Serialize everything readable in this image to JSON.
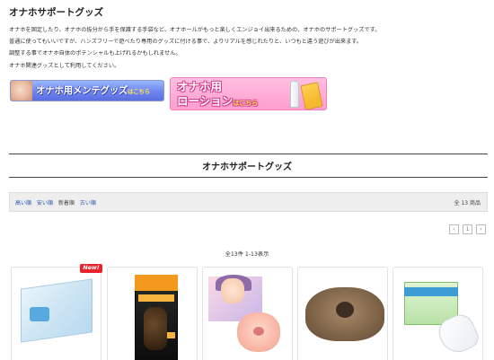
{
  "page": {
    "title": "オナホサポートグッズ",
    "description_lines": [
      "オナホを固定したり、オナホの抜分から手を保護する手袋など、オナホールがもっと楽しくエンジョイ出来るための、オナホのサポートグッズです。",
      "普通に使ってもいいですが、ハンズフリーで遊べたり専用のグッズに付ける事で、よりリアルを感じれたりと、いつもと違う遊びが出来ます。",
      "調整する事でオナホ自体のポテンシャルも上げれるかもしれません。",
      "オナホ関連グッズとして利用してください。"
    ]
  },
  "banners": {
    "maintenance": {
      "main": "オナホ用メンテグッズ",
      "sub": "はこちら"
    },
    "lotion": {
      "line1": "オナホ用",
      "line2": "ローション",
      "sub": "はこちら"
    }
  },
  "section": {
    "heading": "オナホサポートグッズ"
  },
  "sort_bar": {
    "links": [
      "高い順",
      "安い順",
      "新着順",
      "古い順"
    ],
    "count": "全 13 商品"
  },
  "pagination": {
    "prev": "‹",
    "page": "1",
    "next": "›"
  },
  "results": {
    "range": "全13件 1-13表示"
  },
  "products": [
    {
      "badge": "New!"
    },
    {},
    {},
    {},
    {}
  ],
  "colors": {
    "link": "#2a4fb0",
    "new_badge": "#e8232c",
    "sort_bar_bg": "#eeeeee"
  }
}
